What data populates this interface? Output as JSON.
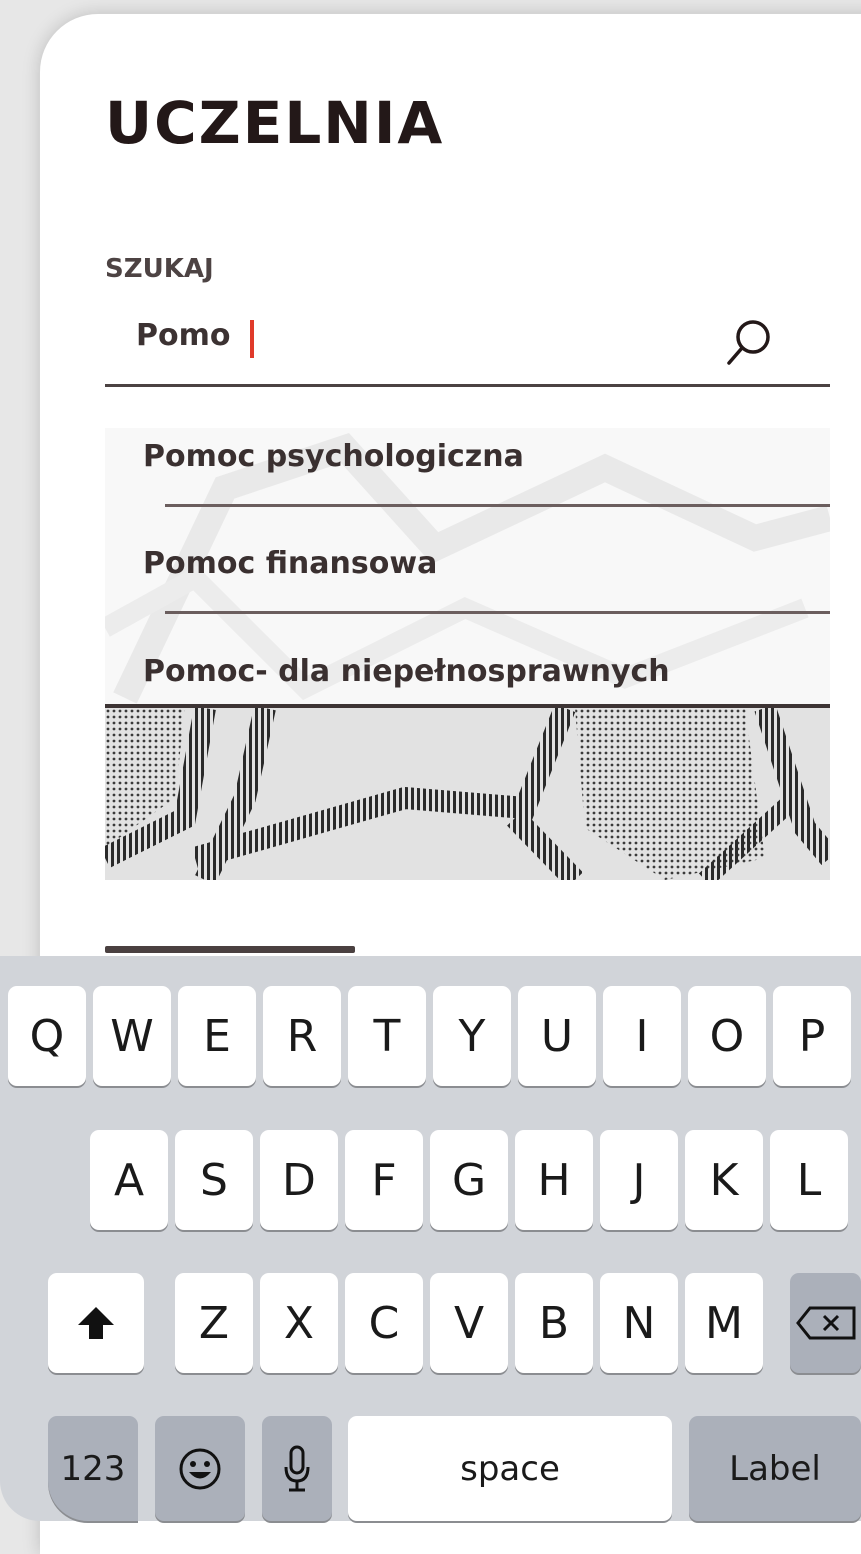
{
  "app": {
    "title": "UCZELNIA"
  },
  "search": {
    "label": "SZUKAJ",
    "value": "Pomo",
    "icon": "search-icon"
  },
  "suggestions": [
    {
      "label": "Pomoc psychologiczna"
    },
    {
      "label": "Pomoc finansowa"
    },
    {
      "label": "Pomoc- dla niepełnosprawnych"
    }
  ],
  "colors": {
    "accent_caret": "#e03a2a",
    "text_dark": "#231818",
    "keyboard_bg": "#d1d4d9"
  },
  "keyboard": {
    "row1": [
      "Q",
      "W",
      "E",
      "R",
      "T",
      "Y",
      "U",
      "I",
      "O",
      "P"
    ],
    "row2": [
      "A",
      "S",
      "D",
      "F",
      "G",
      "H",
      "J",
      "K",
      "L"
    ],
    "row3": [
      "Z",
      "X",
      "C",
      "V",
      "B",
      "N",
      "M"
    ],
    "shift_icon": "shift-arrow-icon",
    "backspace_icon": "backspace-icon",
    "numbers_label": "123",
    "emoji_icon": "emoji-icon",
    "mic_icon": "microphone-icon",
    "space_label": "space",
    "return_label": "Label"
  }
}
